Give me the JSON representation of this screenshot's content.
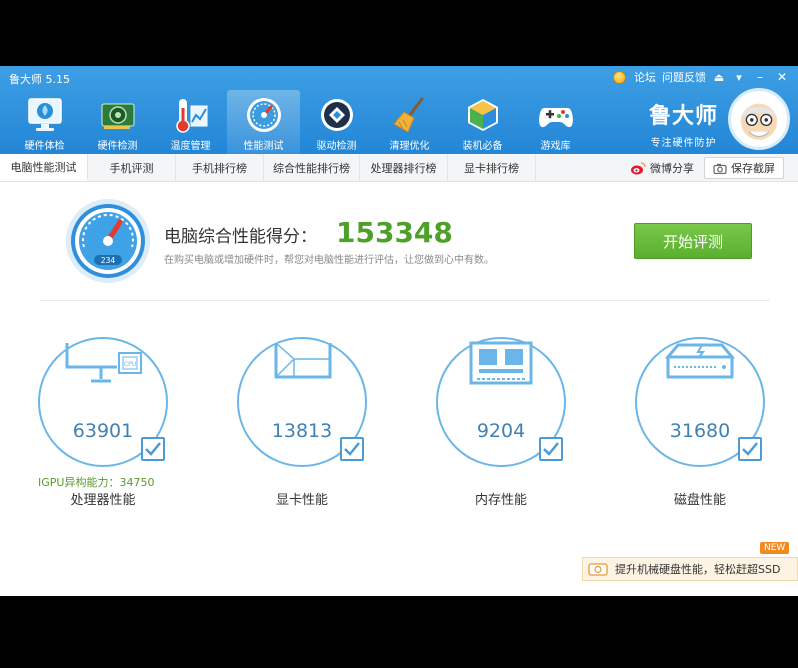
{
  "app": {
    "title": "鲁大师 5.15",
    "top_links": {
      "forum": "论坛",
      "feedback": "问题反馈"
    },
    "brand_name": "鲁大师",
    "brand_slogan": "专注硬件防护"
  },
  "nav": [
    {
      "label": "硬件体检",
      "icon": "monitor-health-icon"
    },
    {
      "label": "硬件检测",
      "icon": "graphics-card-icon"
    },
    {
      "label": "温度管理",
      "icon": "thermometer-icon"
    },
    {
      "label": "性能测试",
      "icon": "gauge-icon",
      "active": true
    },
    {
      "label": "驱动检测",
      "icon": "driver-icon"
    },
    {
      "label": "清理优化",
      "icon": "broom-icon"
    },
    {
      "label": "装机必备",
      "icon": "cube-icon"
    },
    {
      "label": "游戏库",
      "icon": "gamepad-icon"
    }
  ],
  "subtabs": [
    {
      "label": "电脑性能测试",
      "active": true
    },
    {
      "label": "手机评测"
    },
    {
      "label": "手机排行榜"
    },
    {
      "label": "综合性能排行榜"
    },
    {
      "label": "处理器排行榜"
    },
    {
      "label": "显卡排行榜"
    }
  ],
  "subtab_actions": {
    "share": "微博分享",
    "screenshot": "保存截屏"
  },
  "score": {
    "label": "电脑综合性能得分：",
    "value": "153348",
    "description": "在购买电脑或增加硬件时，帮您对电脑性能进行评估，让您做到心中有数。",
    "gauge_text": "234",
    "start_button": "开始评测"
  },
  "metrics": [
    {
      "value": "63901",
      "label": "处理器性能",
      "icon": "cpu-monitor-icon"
    },
    {
      "value": "13813",
      "label": "显卡性能",
      "icon": "gpu-cube-icon"
    },
    {
      "value": "9204",
      "label": "内存性能",
      "icon": "memory-chip-icon"
    },
    {
      "value": "31680",
      "label": "磁盘性能",
      "icon": "hard-disk-icon"
    }
  ],
  "igpu": "IGPU异构能力：34750",
  "promo": {
    "text": "提升机械硬盘性能，轻松赶超SSD",
    "badge": "NEW"
  },
  "colors": {
    "header": "#2f8fdc",
    "score": "#4ea02a",
    "button": "#66b93a",
    "ring": "#6ab6e8"
  }
}
